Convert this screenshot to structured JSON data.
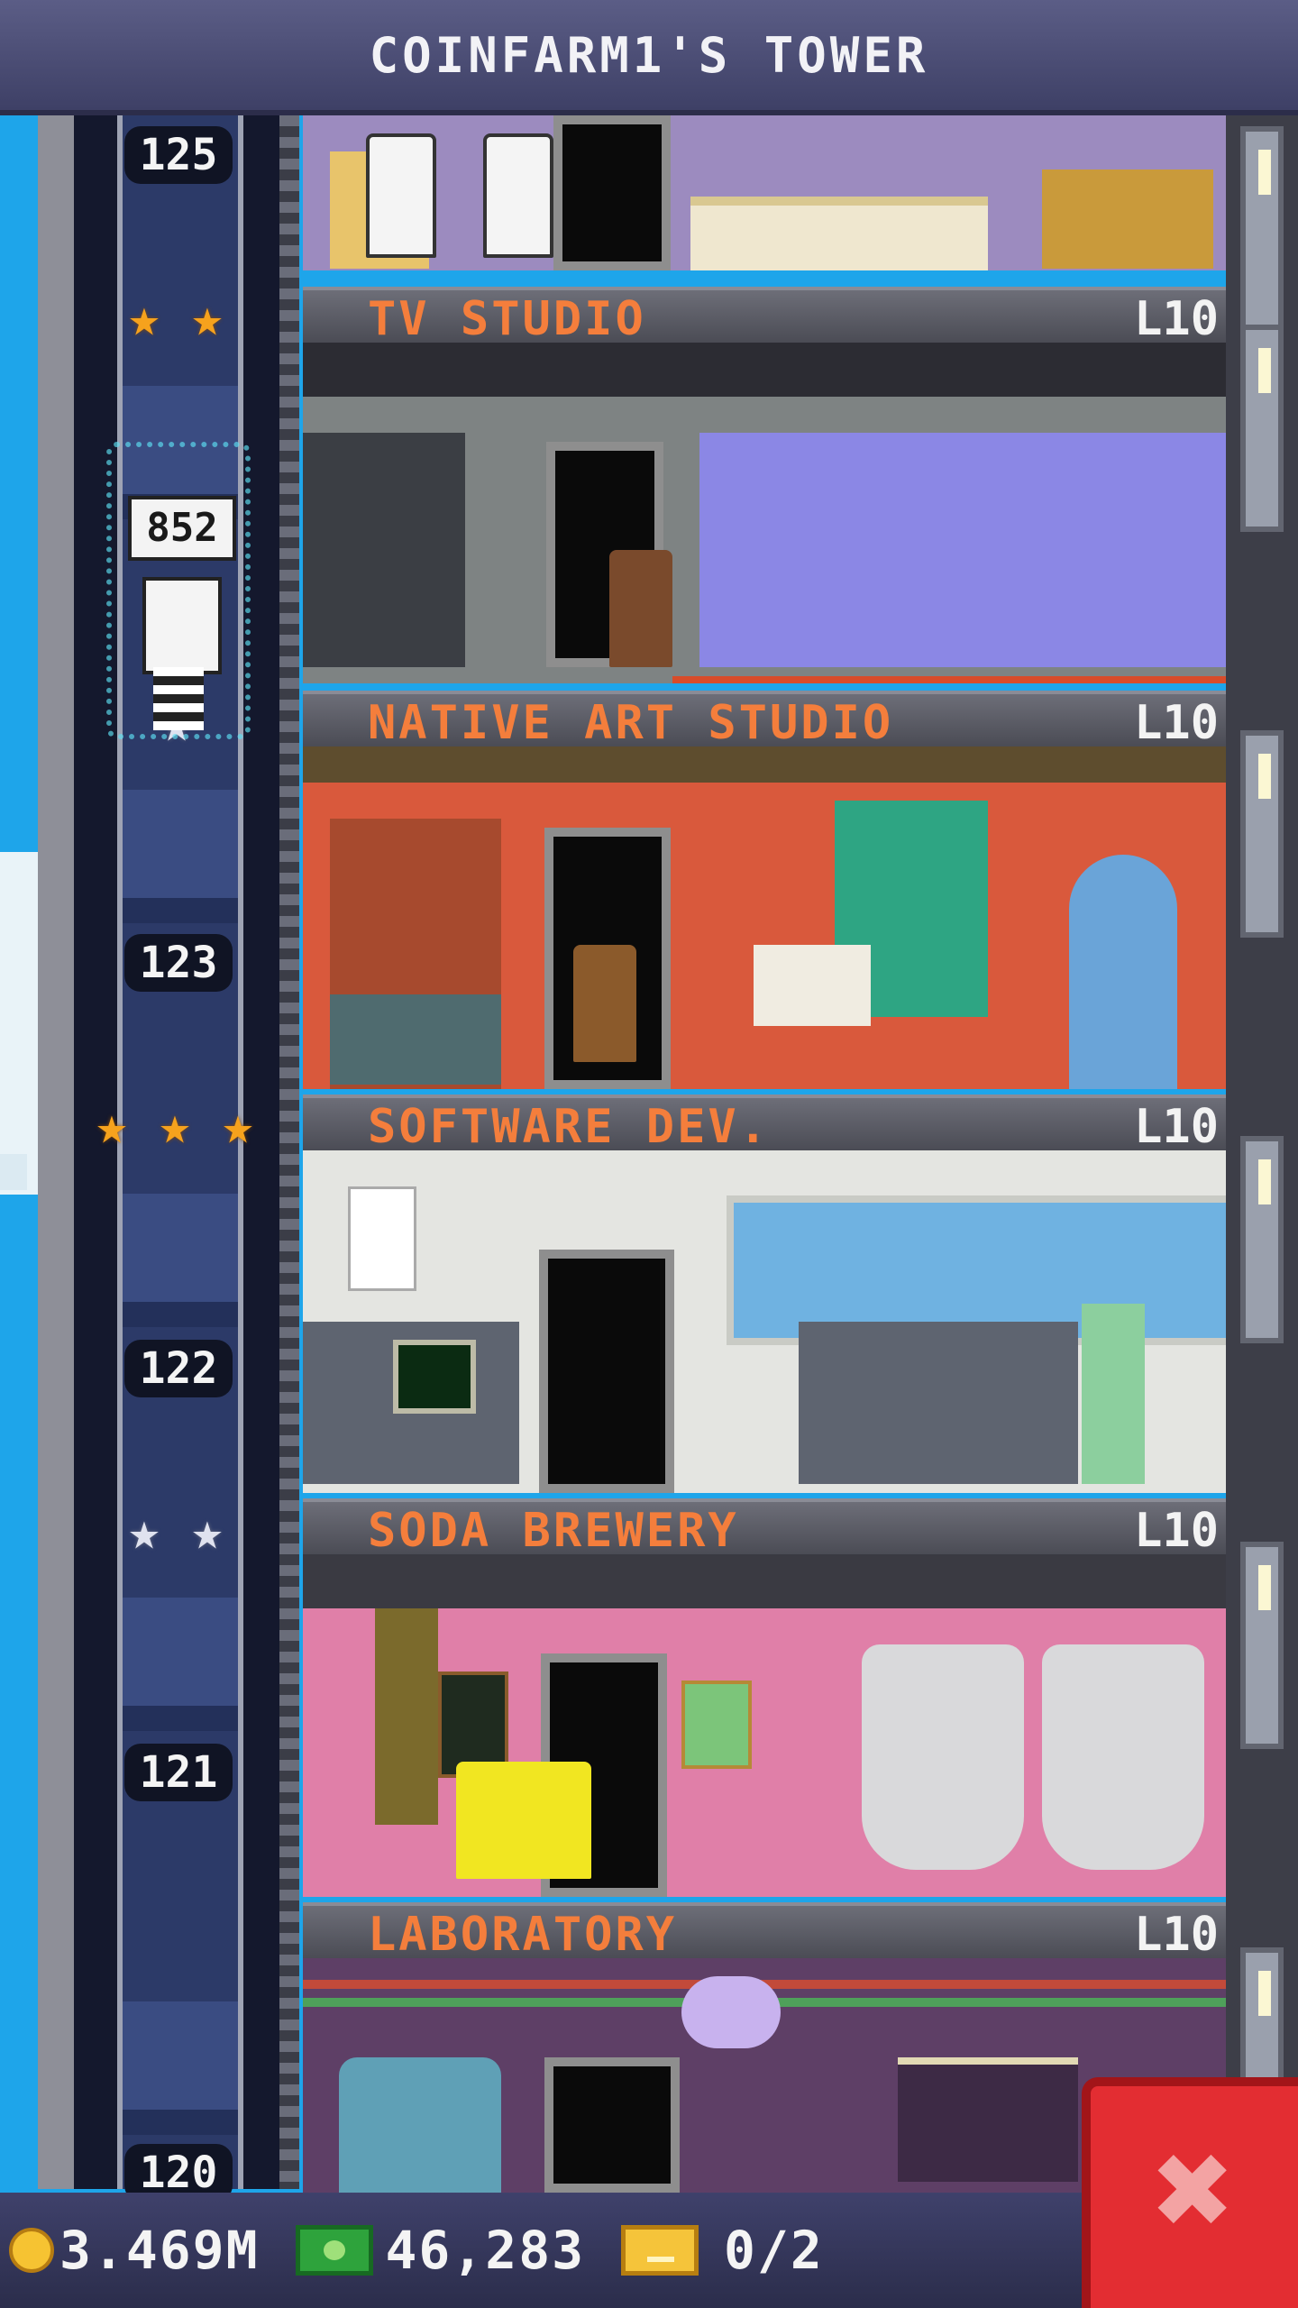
{
  "header": {
    "title": "COINFARM1'S TOWER"
  },
  "elevator": {
    "passenger_count": "852"
  },
  "floors": [
    {
      "number": "125"
    },
    {
      "number": "123"
    },
    {
      "number": "122"
    },
    {
      "number": "121"
    },
    {
      "number": "120"
    }
  ],
  "rooms": [
    {
      "name": "TV STUDIO",
      "level": "L10"
    },
    {
      "name": "NATIVE ART STUDIO",
      "level": "L10"
    },
    {
      "name": "SOFTWARE DEV.",
      "level": "L10"
    },
    {
      "name": "SODA BREWERY",
      "level": "L10"
    },
    {
      "name": "LABORATORY",
      "level": "L10"
    }
  ],
  "ratings": [
    {
      "type": "gold",
      "count": 2
    },
    {
      "type": "silver",
      "count": 1
    },
    {
      "type": "gold",
      "count": 3
    },
    {
      "type": "silver",
      "count": 2
    }
  ],
  "footer": {
    "coins": "3.469M",
    "bux": "46,283",
    "tickets": "0/2"
  },
  "icons": {
    "coin": "coin-icon",
    "bux": "bux-icon",
    "ticket": "vip-ticket-icon",
    "close": "close-icon",
    "star": "star-icon"
  },
  "colors": {
    "label_text": "#f47e3c",
    "close_button": "#e32d32",
    "sky": "#1ea5ea"
  }
}
